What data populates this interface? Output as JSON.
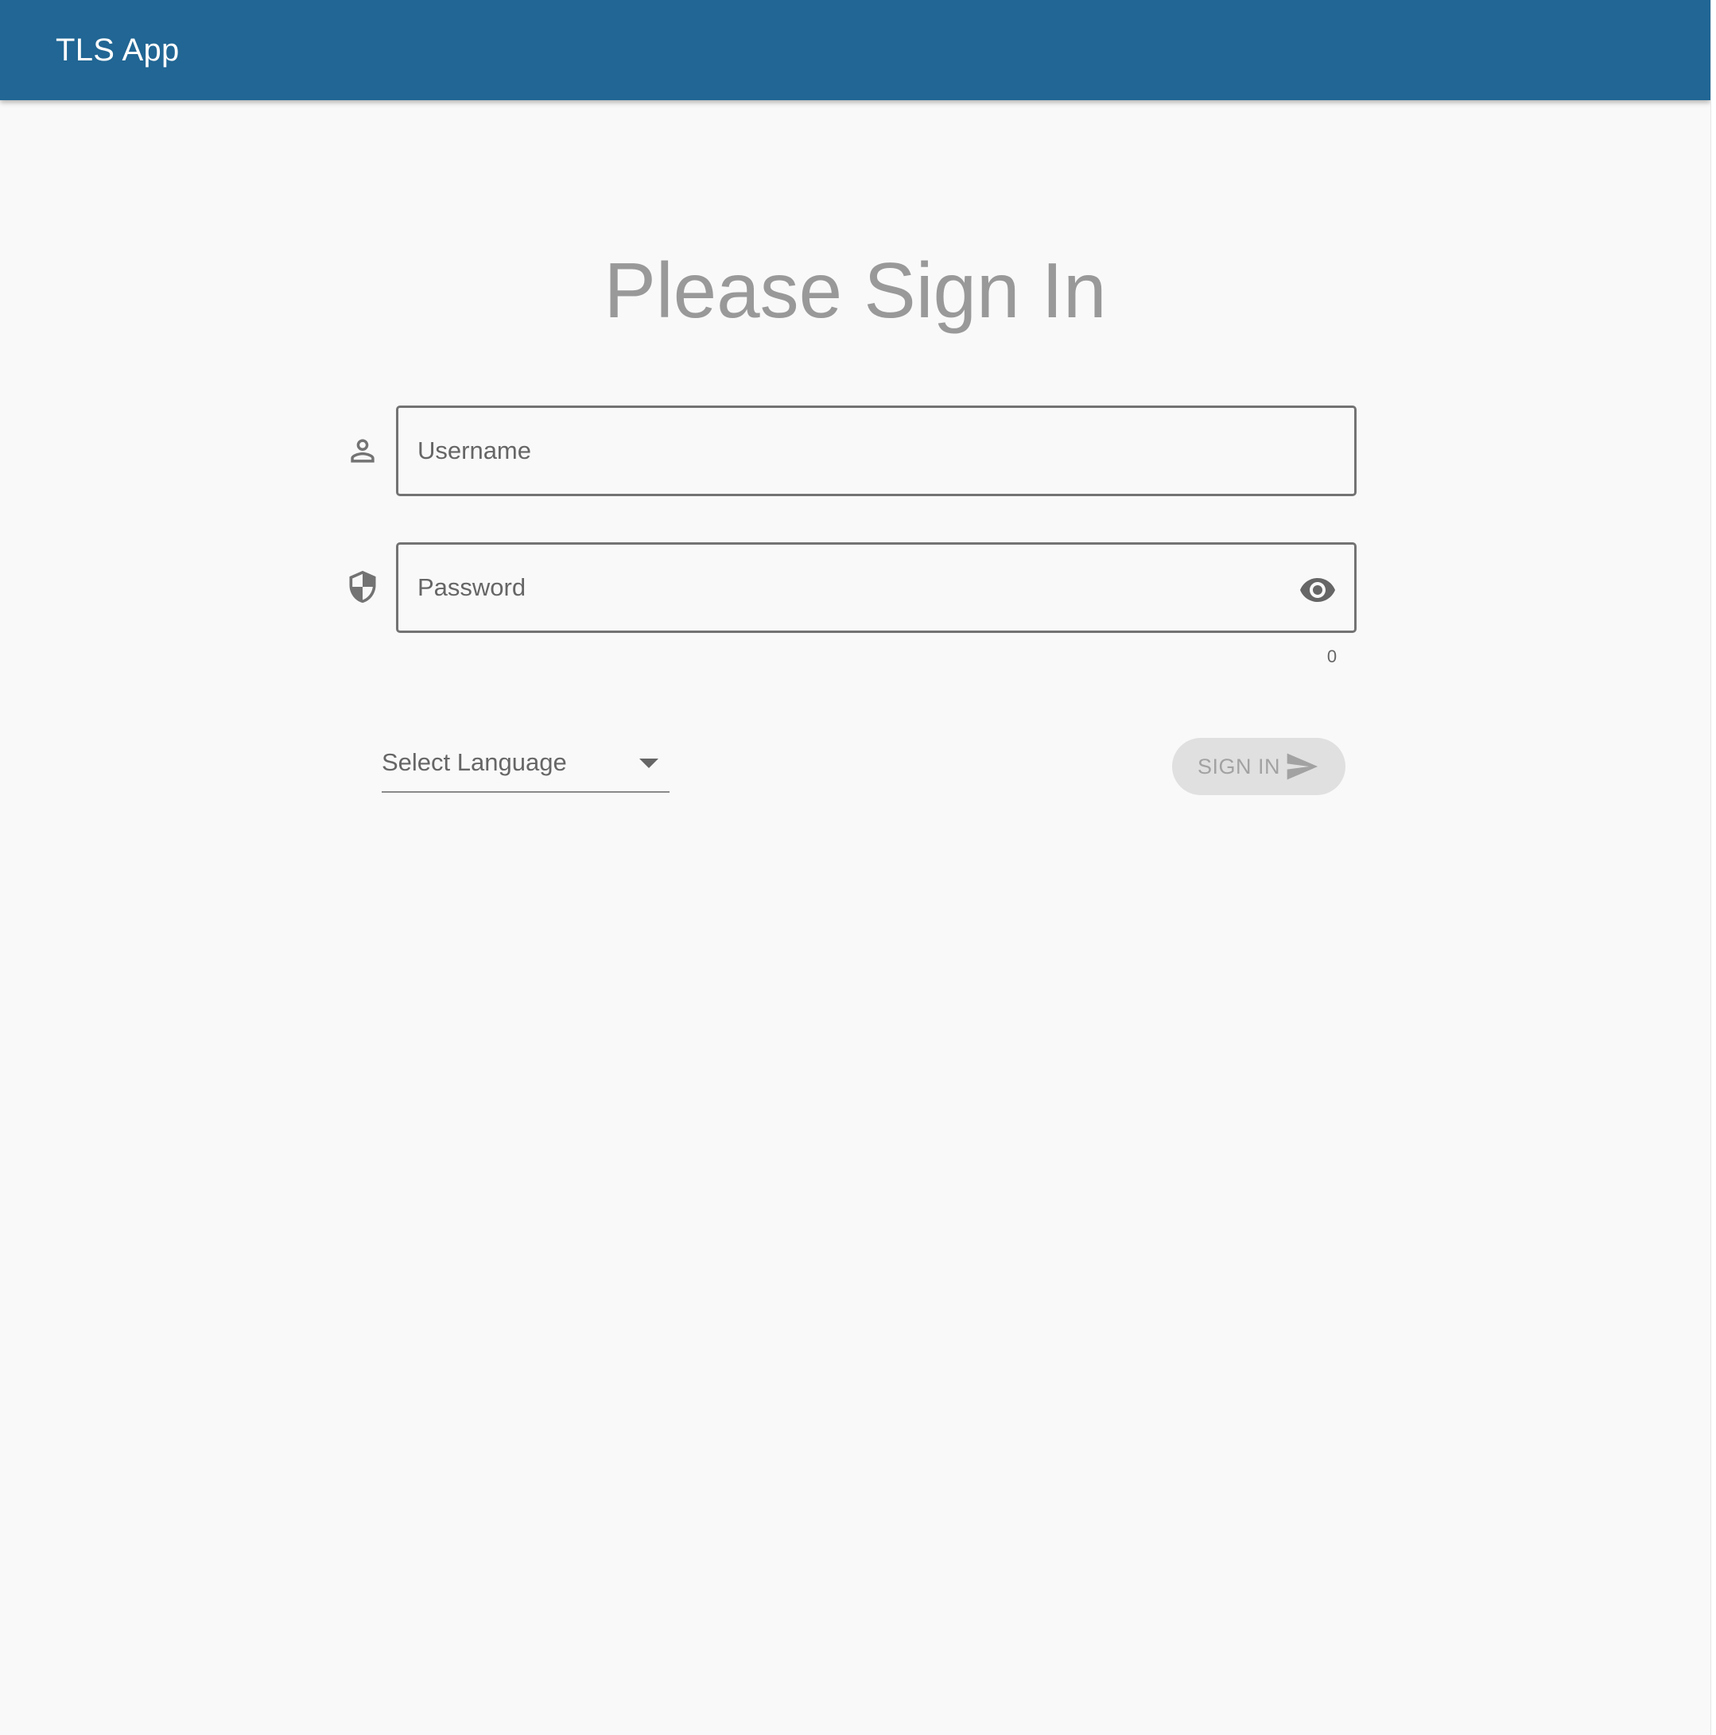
{
  "app_bar": {
    "title": "TLS App",
    "color": "#216694"
  },
  "main": {
    "heading": "Please Sign In",
    "username": {
      "icon": "person-outline-icon",
      "placeholder": "Username",
      "value": ""
    },
    "password": {
      "icon": "shield-icon",
      "placeholder": "Password",
      "value": "",
      "visibility_icon": "eye-icon",
      "char_count": "0"
    },
    "language_select": {
      "label": "Select Language",
      "icon": "caret-down-icon"
    },
    "sign_in_button": {
      "label": "SIGN IN",
      "icon": "send-icon",
      "disabled": true
    }
  }
}
